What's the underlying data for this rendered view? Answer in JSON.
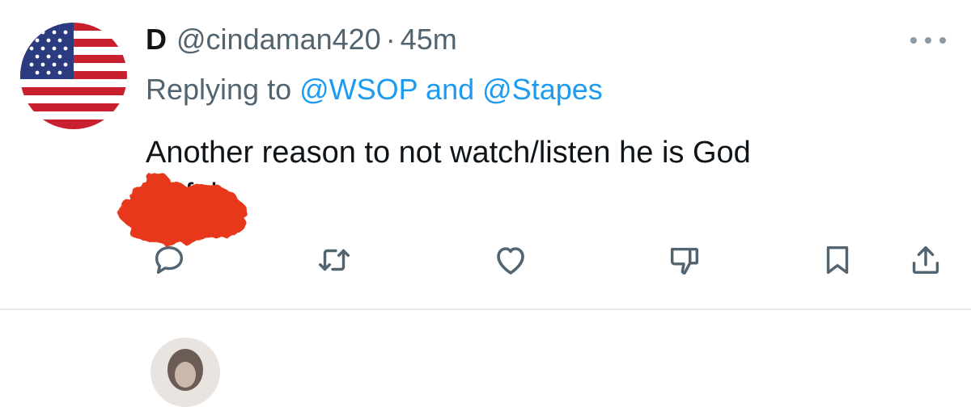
{
  "tweet": {
    "avatar": {
      "description_icon": "us-flag-avatar"
    },
    "display_name": "D",
    "handle": "@cindaman420",
    "separator": "·",
    "time": "45m",
    "more_icon": "more-options-icon",
    "reply": {
      "prefix": "Replying to",
      "mention_1": "@WSOP",
      "conjunction": "and",
      "mention_2": "@Stapes"
    },
    "text": "Another reason to not watch/listen he is God",
    "text_line_2": "awful.",
    "redaction_color": "#e8391c",
    "actions": [
      {
        "icon": "reply-icon"
      },
      {
        "icon": "retweet-icon"
      },
      {
        "icon": "like-icon"
      },
      {
        "icon": "dislike-icon"
      },
      {
        "icon": "bookmark-icon"
      },
      {
        "icon": "share-icon"
      }
    ]
  },
  "colors": {
    "text_primary": "#0f1419",
    "text_secondary": "#536471",
    "link": "#1d9bf0",
    "icon": "#536471",
    "divider": "#e7e9ea"
  }
}
